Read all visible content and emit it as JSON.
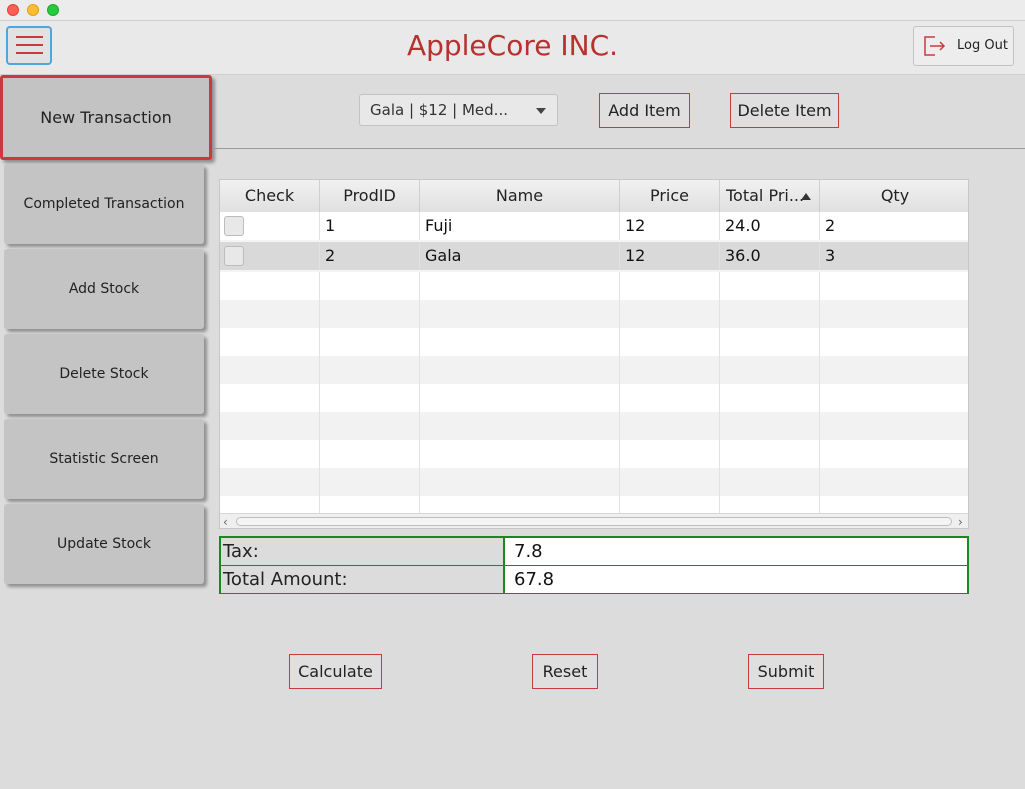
{
  "app": {
    "title": "AppleCore INC.",
    "logout_label": "Log Out"
  },
  "sidebar": {
    "items": [
      {
        "label": "New Transaction",
        "active": true
      },
      {
        "label": "Completed Transaction"
      },
      {
        "label": "Add Stock"
      },
      {
        "label": "Delete Stock"
      },
      {
        "label": "Statistic Screen"
      },
      {
        "label": "Update Stock"
      }
    ]
  },
  "toolbar": {
    "product_select": "Gala   | $12   | Med...",
    "add_item_label": "Add Item",
    "delete_item_label": "Delete Item"
  },
  "table": {
    "columns": [
      "Check",
      "ProdID",
      "Name",
      "Price",
      "Total Pri...",
      "Qty"
    ],
    "sorted_column": "Total Pri...",
    "rows": [
      {
        "checked": false,
        "prodid": "1",
        "name": "Fuji",
        "price": "12",
        "total": "24.0",
        "qty": "2"
      },
      {
        "checked": false,
        "prodid": "2",
        "name": "Gala",
        "price": "12",
        "total": "36.0",
        "qty": "3"
      }
    ]
  },
  "summary": {
    "tax_label": "Tax:",
    "tax_value": "7.8",
    "total_label": "Total Amount:",
    "total_value": "67.8"
  },
  "actions": {
    "calculate": "Calculate",
    "reset": "Reset",
    "submit": "Submit"
  },
  "colors": {
    "accent_red": "#c9393e",
    "title_red": "#b7312f",
    "summary_green": "#178a1f",
    "menu_blue": "#4fa6d8"
  }
}
